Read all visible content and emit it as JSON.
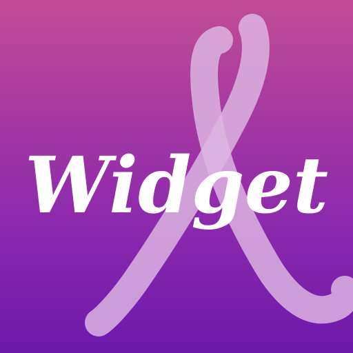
{
  "app_icon": {
    "wordmark": "Widget",
    "monogram": "X"
  },
  "colors": {
    "background_top": "#c14d96",
    "background_bottom": "#6c18ab",
    "monogram": "#dcb4e2",
    "wordmark": "#ffffff"
  }
}
